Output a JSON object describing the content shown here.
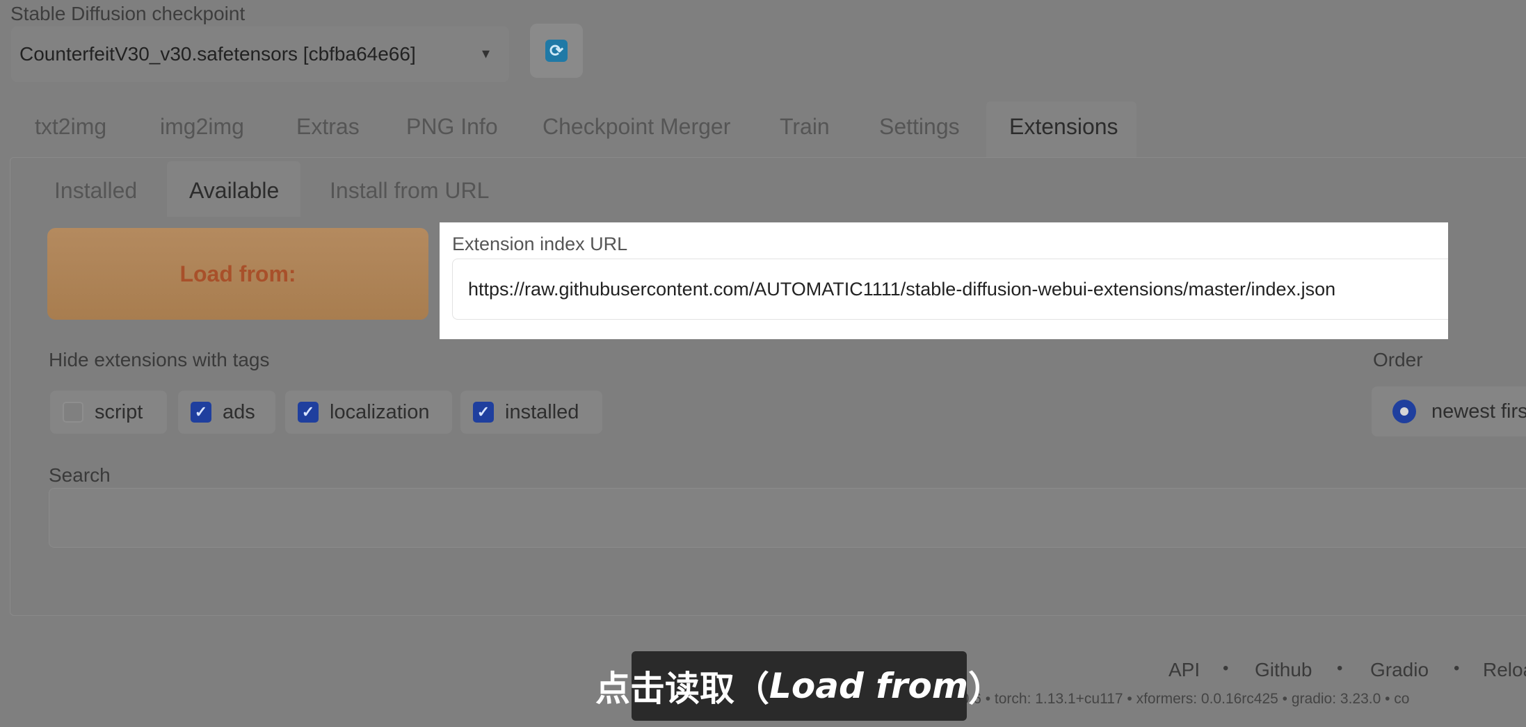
{
  "checkpoint": {
    "label": "Stable Diffusion checkpoint",
    "value": "CounterfeitV30_v30.safetensors [cbfba64e66]",
    "caret": "▾",
    "refresh_glyph": "⟳"
  },
  "main_tabs": [
    "txt2img",
    "img2img",
    "Extras",
    "PNG Info",
    "Checkpoint Merger",
    "Train",
    "Settings",
    "Extensions"
  ],
  "sub_tabs": [
    "Installed",
    "Available",
    "Install from URL"
  ],
  "load_button": "Load from:",
  "extension_index": {
    "label": "Extension index URL",
    "value": "https://raw.githubusercontent.com/AUTOMATIC1111/stable-diffusion-webui-extensions/master/index.json"
  },
  "hide_tags": {
    "label": "Hide extensions with tags",
    "items": [
      {
        "label": "script",
        "checked": false
      },
      {
        "label": "ads",
        "checked": true
      },
      {
        "label": "localization",
        "checked": true
      },
      {
        "label": "installed",
        "checked": true
      }
    ],
    "check_glyph": "✓"
  },
  "order": {
    "label": "Order",
    "selected": "newest first"
  },
  "search": {
    "label": "Search",
    "value": ""
  },
  "footer": {
    "links": [
      "API",
      "Github",
      "Gradio",
      "Reloa"
    ],
    "separator": "•",
    "versions": "10.6  •  torch: 1.13.1+cu117  •  xformers: 0.0.16rc425  •  gradio: 3.23.0  •  co"
  },
  "subtitle": {
    "cn": "点击读取（",
    "en": "Load from",
    "close": "）"
  }
}
